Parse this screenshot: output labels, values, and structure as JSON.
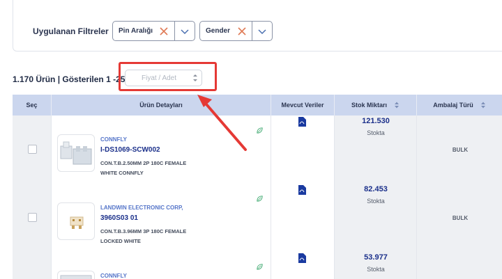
{
  "filters": {
    "title": "Uygulanan Filtreler",
    "chips": [
      {
        "label": "Pin Aralığı"
      },
      {
        "label": "Gender"
      }
    ]
  },
  "results": {
    "count_text": "1.170 Ürün | Gösterilen 1 -25",
    "price_placeholder": "Fiyat / Adet"
  },
  "table": {
    "headers": [
      "Seç",
      "Ürün Detayları",
      "Mevcut Veriler",
      "Stok Miktarı",
      "Ambalaj Türü"
    ],
    "rows": [
      {
        "brand": "CONNFLY",
        "part": "I-DS1069-SCW002",
        "desc1": "CON.T.B.2.50MM 2P 180C FEMALE",
        "desc2": "WHITE CONNFLY",
        "stock": "121.530",
        "stock_label": "Stokta",
        "package": "BULK"
      },
      {
        "brand": "LANDWIN ELECTRONIC CORP,",
        "part": "3960S03 01",
        "desc1": "CON.T.B.3.96MM 3P 180C FEMALE",
        "desc2": "LOCKED WHITE",
        "stock": "82.453",
        "stock_label": "Stokta",
        "package": "BULK"
      },
      {
        "brand": "CONNFLY",
        "part": "",
        "desc1": "",
        "desc2": "",
        "stock": "53.977",
        "stock_label": "Stokta",
        "package": ""
      }
    ]
  },
  "colors": {
    "accent_red": "#e53935",
    "header_bg": "#cbd6ee",
    "link_blue": "#1a2f8a",
    "brand_blue": "#5575c9"
  },
  "icons": {
    "chip_remove": "close-icon",
    "chip_expand": "chevron-down-icon",
    "sort": "sort-icon",
    "datasheet": "pdf-icon",
    "eco": "leaf-icon",
    "annotation": "arrow-annotation"
  }
}
